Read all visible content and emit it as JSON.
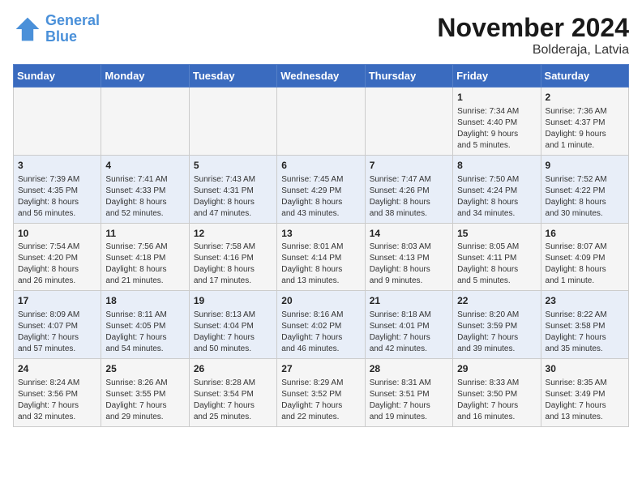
{
  "header": {
    "logo_line1": "General",
    "logo_line2": "Blue",
    "month": "November 2024",
    "location": "Bolderaja, Latvia"
  },
  "weekdays": [
    "Sunday",
    "Monday",
    "Tuesday",
    "Wednesday",
    "Thursday",
    "Friday",
    "Saturday"
  ],
  "weeks": [
    [
      {
        "day": "",
        "info": ""
      },
      {
        "day": "",
        "info": ""
      },
      {
        "day": "",
        "info": ""
      },
      {
        "day": "",
        "info": ""
      },
      {
        "day": "",
        "info": ""
      },
      {
        "day": "1",
        "info": "Sunrise: 7:34 AM\nSunset: 4:40 PM\nDaylight: 9 hours\nand 5 minutes."
      },
      {
        "day": "2",
        "info": "Sunrise: 7:36 AM\nSunset: 4:37 PM\nDaylight: 9 hours\nand 1 minute."
      }
    ],
    [
      {
        "day": "3",
        "info": "Sunrise: 7:39 AM\nSunset: 4:35 PM\nDaylight: 8 hours\nand 56 minutes."
      },
      {
        "day": "4",
        "info": "Sunrise: 7:41 AM\nSunset: 4:33 PM\nDaylight: 8 hours\nand 52 minutes."
      },
      {
        "day": "5",
        "info": "Sunrise: 7:43 AM\nSunset: 4:31 PM\nDaylight: 8 hours\nand 47 minutes."
      },
      {
        "day": "6",
        "info": "Sunrise: 7:45 AM\nSunset: 4:29 PM\nDaylight: 8 hours\nand 43 minutes."
      },
      {
        "day": "7",
        "info": "Sunrise: 7:47 AM\nSunset: 4:26 PM\nDaylight: 8 hours\nand 38 minutes."
      },
      {
        "day": "8",
        "info": "Sunrise: 7:50 AM\nSunset: 4:24 PM\nDaylight: 8 hours\nand 34 minutes."
      },
      {
        "day": "9",
        "info": "Sunrise: 7:52 AM\nSunset: 4:22 PM\nDaylight: 8 hours\nand 30 minutes."
      }
    ],
    [
      {
        "day": "10",
        "info": "Sunrise: 7:54 AM\nSunset: 4:20 PM\nDaylight: 8 hours\nand 26 minutes."
      },
      {
        "day": "11",
        "info": "Sunrise: 7:56 AM\nSunset: 4:18 PM\nDaylight: 8 hours\nand 21 minutes."
      },
      {
        "day": "12",
        "info": "Sunrise: 7:58 AM\nSunset: 4:16 PM\nDaylight: 8 hours\nand 17 minutes."
      },
      {
        "day": "13",
        "info": "Sunrise: 8:01 AM\nSunset: 4:14 PM\nDaylight: 8 hours\nand 13 minutes."
      },
      {
        "day": "14",
        "info": "Sunrise: 8:03 AM\nSunset: 4:13 PM\nDaylight: 8 hours\nand 9 minutes."
      },
      {
        "day": "15",
        "info": "Sunrise: 8:05 AM\nSunset: 4:11 PM\nDaylight: 8 hours\nand 5 minutes."
      },
      {
        "day": "16",
        "info": "Sunrise: 8:07 AM\nSunset: 4:09 PM\nDaylight: 8 hours\nand 1 minute."
      }
    ],
    [
      {
        "day": "17",
        "info": "Sunrise: 8:09 AM\nSunset: 4:07 PM\nDaylight: 7 hours\nand 57 minutes."
      },
      {
        "day": "18",
        "info": "Sunrise: 8:11 AM\nSunset: 4:05 PM\nDaylight: 7 hours\nand 54 minutes."
      },
      {
        "day": "19",
        "info": "Sunrise: 8:13 AM\nSunset: 4:04 PM\nDaylight: 7 hours\nand 50 minutes."
      },
      {
        "day": "20",
        "info": "Sunrise: 8:16 AM\nSunset: 4:02 PM\nDaylight: 7 hours\nand 46 minutes."
      },
      {
        "day": "21",
        "info": "Sunrise: 8:18 AM\nSunset: 4:01 PM\nDaylight: 7 hours\nand 42 minutes."
      },
      {
        "day": "22",
        "info": "Sunrise: 8:20 AM\nSunset: 3:59 PM\nDaylight: 7 hours\nand 39 minutes."
      },
      {
        "day": "23",
        "info": "Sunrise: 8:22 AM\nSunset: 3:58 PM\nDaylight: 7 hours\nand 35 minutes."
      }
    ],
    [
      {
        "day": "24",
        "info": "Sunrise: 8:24 AM\nSunset: 3:56 PM\nDaylight: 7 hours\nand 32 minutes."
      },
      {
        "day": "25",
        "info": "Sunrise: 8:26 AM\nSunset: 3:55 PM\nDaylight: 7 hours\nand 29 minutes."
      },
      {
        "day": "26",
        "info": "Sunrise: 8:28 AM\nSunset: 3:54 PM\nDaylight: 7 hours\nand 25 minutes."
      },
      {
        "day": "27",
        "info": "Sunrise: 8:29 AM\nSunset: 3:52 PM\nDaylight: 7 hours\nand 22 minutes."
      },
      {
        "day": "28",
        "info": "Sunrise: 8:31 AM\nSunset: 3:51 PM\nDaylight: 7 hours\nand 19 minutes."
      },
      {
        "day": "29",
        "info": "Sunrise: 8:33 AM\nSunset: 3:50 PM\nDaylight: 7 hours\nand 16 minutes."
      },
      {
        "day": "30",
        "info": "Sunrise: 8:35 AM\nSunset: 3:49 PM\nDaylight: 7 hours\nand 13 minutes."
      }
    ]
  ]
}
